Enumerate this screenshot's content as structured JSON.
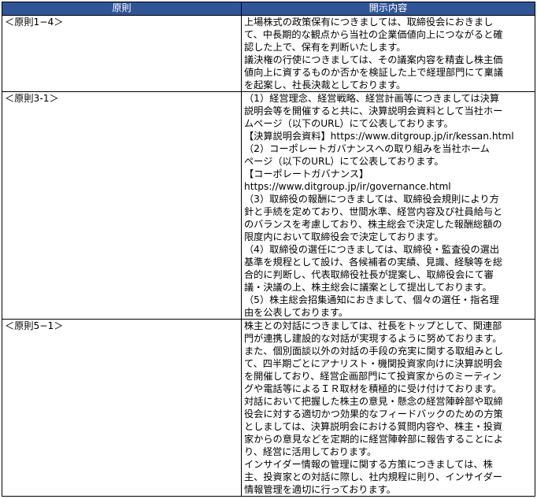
{
  "table": {
    "headers": {
      "principle": "原則",
      "content": "開示内容"
    },
    "rows": [
      {
        "principle": "＜原則1−4＞",
        "lines": [
          "上場株式の政策保有につきましては、取締役会におきまし",
          "て、中長期的な観点から当社の企業価値向上につながると確",
          "認した上で、保有を判断いたします。",
          "議決権の行使につきましては、その議案内容を精査し株主価",
          "値向上に資するものか否かを検証した上で経理部門にて稟議",
          "を起案し、社長決裁としております。"
        ]
      },
      {
        "principle": "＜原則3-1＞",
        "lines": [
          "（1）経営理念、経営戦略、経営計画等につきましては決算",
          "説明会等を開催すると共に、決算説明会資料として当社ホー",
          "ムページ（以下のURL）にて公表しております。",
          "【決算説明会資料】https://www.ditgroup.jp/ir/kessan.html",
          "（2）コーポレートガバナンスへの取り組みを当社ホーム",
          "ページ（以下のURL）にて公表しております。",
          "【コーポレートガバナンス】",
          "https://www.ditgroup.jp/ir/governance.html",
          "（3）取締役の報酬につきましては、取締役会規則により方",
          "針と手続を定めており、世間水準、経営内容及び社員給与と",
          "のバランスを考慮しており、株主総会で決定した報酬総額の",
          "限度内において取締役会で決定しております。",
          "（4）取締役の選任につきましては、取締役・監査役の選出",
          "基準を規程として設け、各候補者の実績、見識、経験等を総",
          "合的に判断し、代表取締役社長が提案し、取締役会にて審",
          "議・決議の上、株主総会に議案として提出しております。",
          "（5）株主総会招集通知におきまして、個々の選任・指名理",
          "由を公表しております。"
        ]
      },
      {
        "principle": "＜原則5−1＞",
        "lines": [
          "株主との対話につきましては、社長をトップとして、関連部",
          "門が連携し建設的な対話が実現するように努めております。",
          "また、個別面談以外の対話の手段の充実に関する取組みとし",
          "て、四半期ごとにアナリスト・機関投資家向けに決算説明会",
          "を開催しており、経営企画部門にて投資家からのミーティン",
          "グや電話等によるＩＲ取材を積極的に受け付けております。",
          "対話において把握した株主の意見・懸念の経営陣幹部や取締",
          "役会に対する適切かつ効果的なフィードバックのための方策",
          "としましては、決算説明会における質問内容や、株主・投資",
          "家からの意見などを定期的に経営陣幹部に報告することによ",
          "り、経営に活用しております。",
          "インサイダー情報の管理に関する方策につきましては、株",
          "主、投資家との対話に際し、社内規程に則り、インサイダー",
          "情報管理を適切に行っております。"
        ]
      }
    ]
  },
  "colors": {
    "header_background": "#2f5597",
    "header_text": "#ffffff",
    "border": "#000000"
  }
}
